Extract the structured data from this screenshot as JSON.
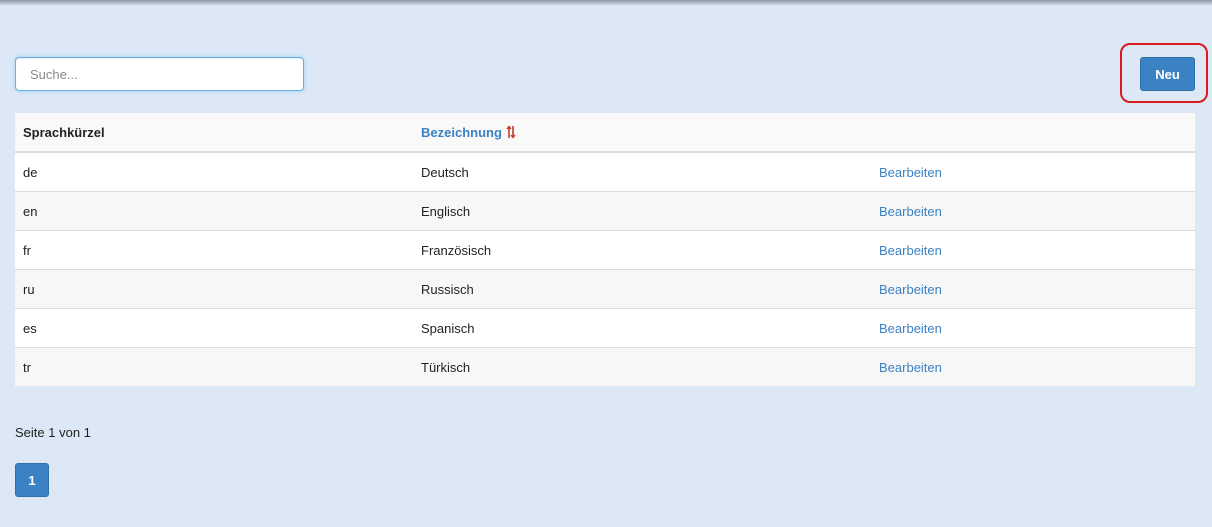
{
  "search": {
    "placeholder": "Suche...",
    "value": ""
  },
  "toolbar": {
    "new_label": "Neu"
  },
  "table": {
    "columns": [
      "Sprachkürzel",
      "Bezeichnung"
    ],
    "rows": [
      {
        "code": "de",
        "name": "Deutsch",
        "action": "Bearbeiten"
      },
      {
        "code": "en",
        "name": "Englisch",
        "action": "Bearbeiten"
      },
      {
        "code": "fr",
        "name": "Französisch",
        "action": "Bearbeiten"
      },
      {
        "code": "ru",
        "name": "Russisch",
        "action": "Bearbeiten"
      },
      {
        "code": "es",
        "name": "Spanisch",
        "action": "Bearbeiten"
      },
      {
        "code": "tr",
        "name": "Türkisch",
        "action": "Bearbeiten"
      }
    ]
  },
  "pagination": {
    "info": "Seite 1 von 1",
    "pages": [
      "1"
    ]
  },
  "icons": {
    "sort": "sort-icon"
  },
  "colors": {
    "accent": "#3b82c4",
    "highlight": "#d81b1b",
    "sort_icon": "#c0392b",
    "background": "#dce8f6"
  }
}
